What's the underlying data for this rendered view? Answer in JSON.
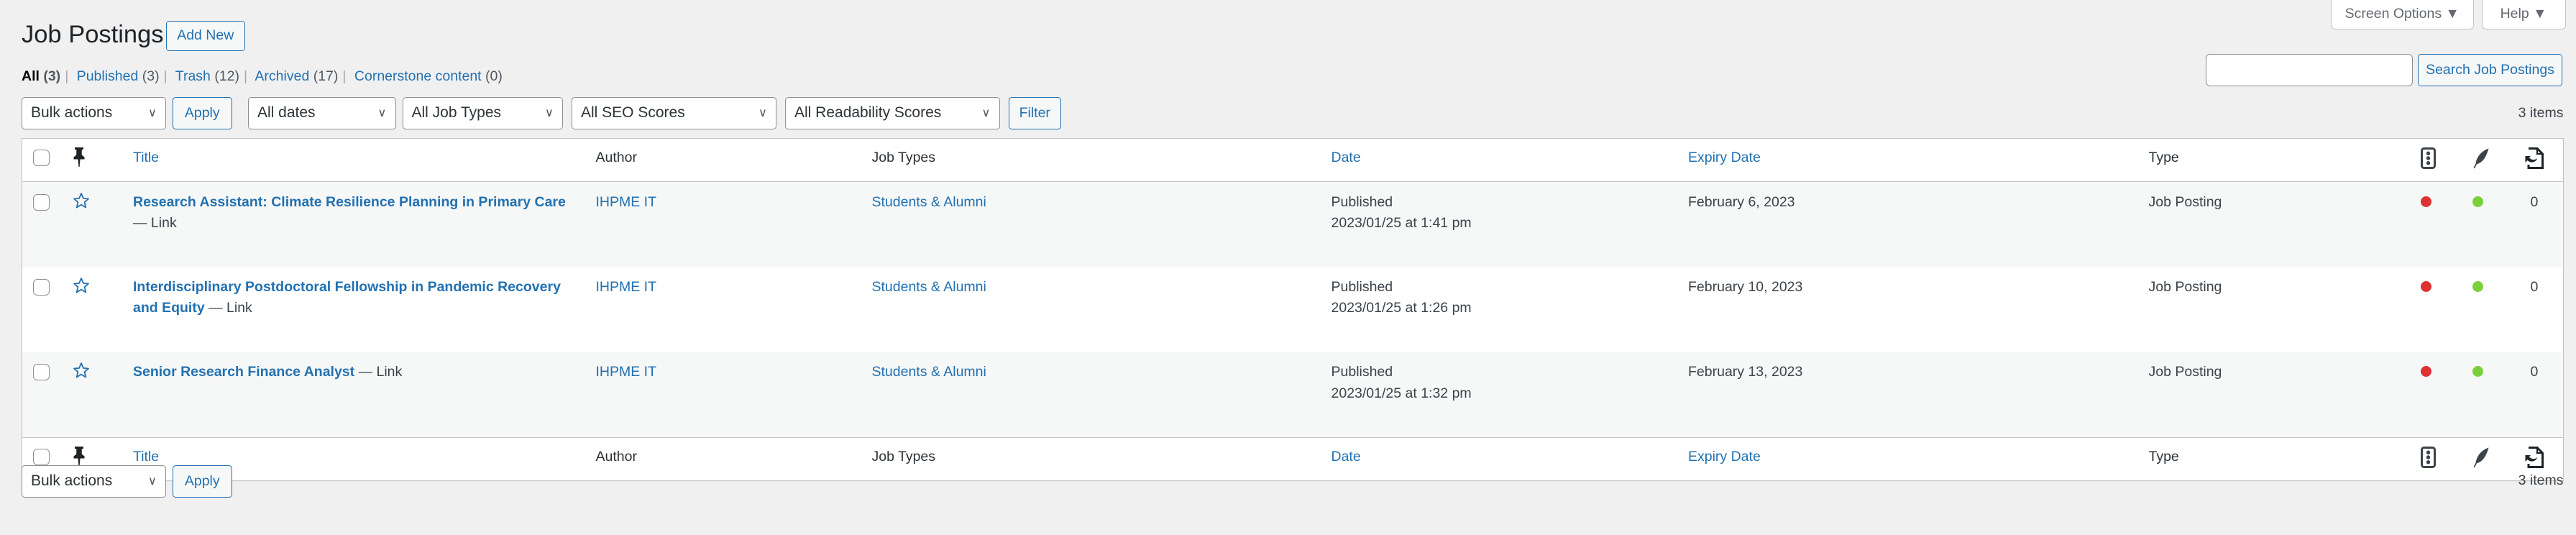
{
  "header": {
    "title": "Job Postings",
    "add_new": "Add New",
    "screen_options": "Screen Options",
    "help": "Help"
  },
  "views": [
    {
      "label": "All",
      "count": "(3)"
    },
    {
      "label": "Published",
      "count": "(3)"
    },
    {
      "label": "Trash",
      "count": "(12)"
    },
    {
      "label": "Archived",
      "count": "(17)"
    },
    {
      "label": "Cornerstone content",
      "count": "(0)"
    }
  ],
  "search": {
    "value": "",
    "placeholder": "",
    "button": "Search Job Postings"
  },
  "filters": {
    "bulk_actions": "Bulk actions",
    "apply": "Apply",
    "dates": "All dates",
    "job_types": "All Job Types",
    "seo": "All SEO Scores",
    "readability": "All Readability Scores",
    "filter": "Filter"
  },
  "items_count": "3 items",
  "columns": {
    "title": "Title",
    "author": "Author",
    "job_types": "Job Types",
    "date": "Date",
    "expiry": "Expiry Date",
    "type": "Type"
  },
  "rows": [
    {
      "title": "Research Assistant: Climate Resilience Planning in Primary Care",
      "suffix": "— Link",
      "author": "IHPME IT",
      "job_types": "Students & Alumni",
      "status": "Published",
      "date": "2023/01/25 at 1:41 pm",
      "expiry": "February 6, 2023",
      "type": "Job Posting",
      "links": "0"
    },
    {
      "title": "Interdisciplinary Postdoctoral Fellowship in Pandemic Recovery and Equity",
      "suffix": "— Link",
      "author": "IHPME IT",
      "job_types": "Students & Alumni",
      "status": "Published",
      "date": "2023/01/25 at 1:26 pm",
      "expiry": "February 10, 2023",
      "type": "Job Posting",
      "links": "0"
    },
    {
      "title": "Senior Research Finance Analyst",
      "suffix": "— Link",
      "author": "IHPME IT",
      "job_types": "Students & Alumni",
      "status": "Published",
      "date": "2023/01/25 at 1:32 pm",
      "expiry": "February 13, 2023",
      "type": "Job Posting",
      "links": "0"
    }
  ],
  "colors": {
    "seo_bad": "#dc3232",
    "readability_good": "#7ad03a",
    "accent": "#2271b1"
  }
}
